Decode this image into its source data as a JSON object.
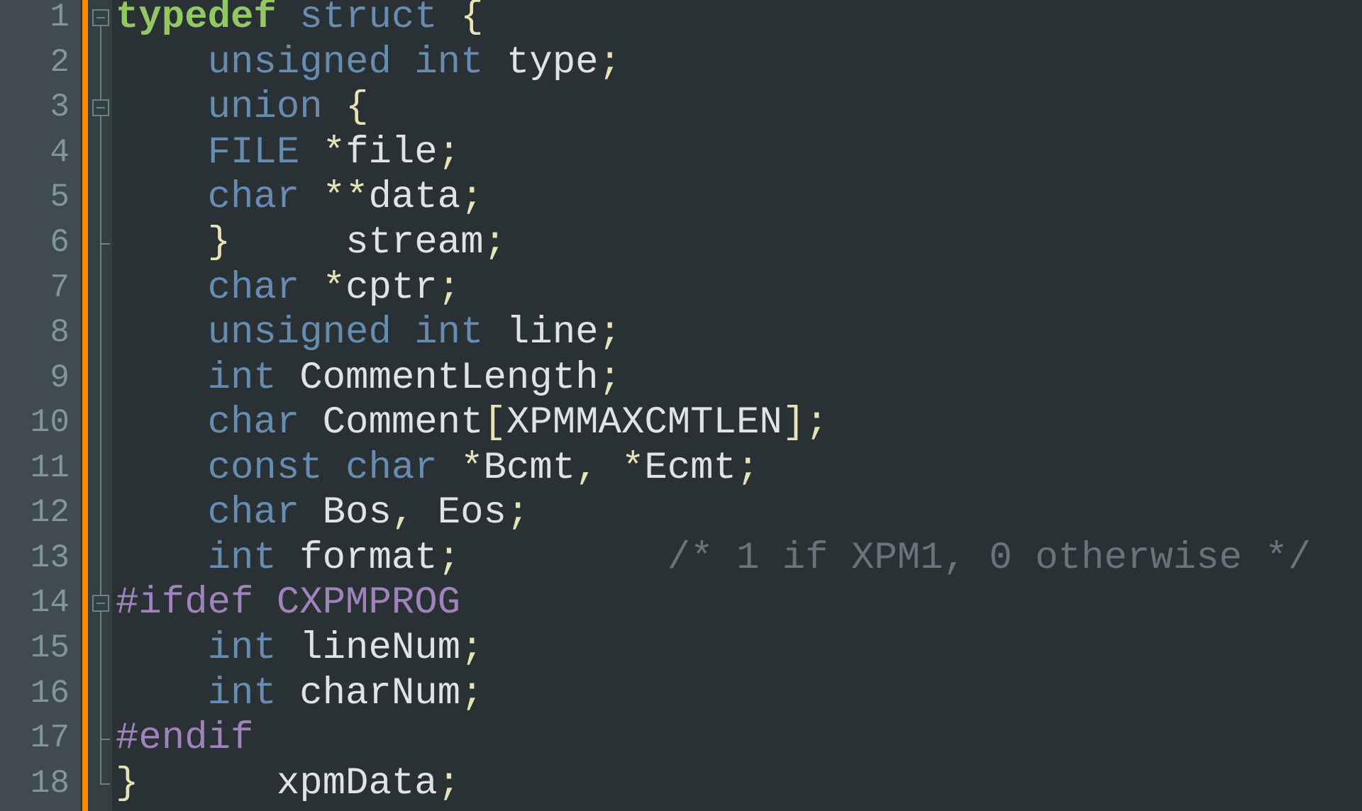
{
  "editor": {
    "theme_colors": {
      "background": "#293134",
      "gutter": "#3f4b4e",
      "change_bar": "#ff8a00",
      "fold_margin": "#343f42",
      "line_number": "#81969a",
      "keyword": "#93c763",
      "type": "#678cb1",
      "identifier": "#e0e2e4",
      "operator": "#e8e2b7",
      "preprocessor": "#a082bd",
      "comment": "#66747b"
    },
    "lines": [
      {
        "number": "1",
        "fold": "open",
        "tokens": [
          {
            "t": "kwd",
            "v": "typedef"
          },
          {
            "t": "ws",
            "v": " "
          },
          {
            "t": "type",
            "v": "struct"
          },
          {
            "t": "ws",
            "v": " "
          },
          {
            "t": "op",
            "v": "{"
          }
        ]
      },
      {
        "number": "2",
        "fold": "line",
        "tokens": [
          {
            "t": "ws",
            "v": "    "
          },
          {
            "t": "type",
            "v": "unsigned"
          },
          {
            "t": "ws",
            "v": " "
          },
          {
            "t": "type",
            "v": "int"
          },
          {
            "t": "ws",
            "v": " "
          },
          {
            "t": "id",
            "v": "type"
          },
          {
            "t": "op",
            "v": ";"
          }
        ]
      },
      {
        "number": "3",
        "fold": "open",
        "tokens": [
          {
            "t": "ws",
            "v": "    "
          },
          {
            "t": "type",
            "v": "union"
          },
          {
            "t": "ws",
            "v": " "
          },
          {
            "t": "op",
            "v": "{"
          }
        ]
      },
      {
        "number": "4",
        "fold": "line",
        "tokens": [
          {
            "t": "ws",
            "v": "    "
          },
          {
            "t": "type",
            "v": "FILE"
          },
          {
            "t": "ws",
            "v": " "
          },
          {
            "t": "op",
            "v": "*"
          },
          {
            "t": "id",
            "v": "file"
          },
          {
            "t": "op",
            "v": ";"
          }
        ]
      },
      {
        "number": "5",
        "fold": "line",
        "tokens": [
          {
            "t": "ws",
            "v": "    "
          },
          {
            "t": "type",
            "v": "char"
          },
          {
            "t": "ws",
            "v": " "
          },
          {
            "t": "op",
            "v": "**"
          },
          {
            "t": "id",
            "v": "data"
          },
          {
            "t": "op",
            "v": ";"
          }
        ]
      },
      {
        "number": "6",
        "fold": "end",
        "tokens": [
          {
            "t": "ws",
            "v": "    "
          },
          {
            "t": "op",
            "v": "}"
          },
          {
            "t": "ws",
            "v": "     "
          },
          {
            "t": "id",
            "v": "stream"
          },
          {
            "t": "op",
            "v": ";"
          }
        ]
      },
      {
        "number": "7",
        "fold": "line",
        "tokens": [
          {
            "t": "ws",
            "v": "    "
          },
          {
            "t": "type",
            "v": "char"
          },
          {
            "t": "ws",
            "v": " "
          },
          {
            "t": "op",
            "v": "*"
          },
          {
            "t": "id",
            "v": "cptr"
          },
          {
            "t": "op",
            "v": ";"
          }
        ]
      },
      {
        "number": "8",
        "fold": "line",
        "tokens": [
          {
            "t": "ws",
            "v": "    "
          },
          {
            "t": "type",
            "v": "unsigned"
          },
          {
            "t": "ws",
            "v": " "
          },
          {
            "t": "type",
            "v": "int"
          },
          {
            "t": "ws",
            "v": " "
          },
          {
            "t": "id",
            "v": "line"
          },
          {
            "t": "op",
            "v": ";"
          }
        ]
      },
      {
        "number": "9",
        "fold": "line",
        "tokens": [
          {
            "t": "ws",
            "v": "    "
          },
          {
            "t": "type",
            "v": "int"
          },
          {
            "t": "ws",
            "v": " "
          },
          {
            "t": "id",
            "v": "CommentLength"
          },
          {
            "t": "op",
            "v": ";"
          }
        ]
      },
      {
        "number": "10",
        "fold": "line",
        "tokens": [
          {
            "t": "ws",
            "v": "    "
          },
          {
            "t": "type",
            "v": "char"
          },
          {
            "t": "ws",
            "v": " "
          },
          {
            "t": "id",
            "v": "Comment"
          },
          {
            "t": "op",
            "v": "["
          },
          {
            "t": "id",
            "v": "XPMMAXCMTLEN"
          },
          {
            "t": "op",
            "v": "];"
          }
        ]
      },
      {
        "number": "11",
        "fold": "line",
        "tokens": [
          {
            "t": "ws",
            "v": "    "
          },
          {
            "t": "type",
            "v": "const"
          },
          {
            "t": "ws",
            "v": " "
          },
          {
            "t": "type",
            "v": "char"
          },
          {
            "t": "ws",
            "v": " "
          },
          {
            "t": "op",
            "v": "*"
          },
          {
            "t": "id",
            "v": "Bcmt"
          },
          {
            "t": "op",
            "v": ","
          },
          {
            "t": "ws",
            "v": " "
          },
          {
            "t": "op",
            "v": "*"
          },
          {
            "t": "id",
            "v": "Ecmt"
          },
          {
            "t": "op",
            "v": ";"
          }
        ]
      },
      {
        "number": "12",
        "fold": "line",
        "tokens": [
          {
            "t": "ws",
            "v": "    "
          },
          {
            "t": "type",
            "v": "char"
          },
          {
            "t": "ws",
            "v": " "
          },
          {
            "t": "id",
            "v": "Bos"
          },
          {
            "t": "op",
            "v": ","
          },
          {
            "t": "ws",
            "v": " "
          },
          {
            "t": "id",
            "v": "Eos"
          },
          {
            "t": "op",
            "v": ";"
          }
        ]
      },
      {
        "number": "13",
        "fold": "line",
        "tokens": [
          {
            "t": "ws",
            "v": "    "
          },
          {
            "t": "type",
            "v": "int"
          },
          {
            "t": "ws",
            "v": " "
          },
          {
            "t": "id",
            "v": "format"
          },
          {
            "t": "op",
            "v": ";"
          },
          {
            "t": "ws",
            "v": "         "
          },
          {
            "t": "cmt",
            "v": "/* 1 if XPM1, 0 otherwise */"
          }
        ]
      },
      {
        "number": "14",
        "fold": "open",
        "tokens": [
          {
            "t": "pre",
            "v": "#ifdef"
          },
          {
            "t": "ws",
            "v": " "
          },
          {
            "t": "pre",
            "v": "CXPMPROG"
          }
        ]
      },
      {
        "number": "15",
        "fold": "line",
        "tokens": [
          {
            "t": "ws",
            "v": "    "
          },
          {
            "t": "type",
            "v": "int"
          },
          {
            "t": "ws",
            "v": " "
          },
          {
            "t": "id",
            "v": "lineNum"
          },
          {
            "t": "op",
            "v": ";"
          }
        ]
      },
      {
        "number": "16",
        "fold": "line",
        "tokens": [
          {
            "t": "ws",
            "v": "    "
          },
          {
            "t": "type",
            "v": "int"
          },
          {
            "t": "ws",
            "v": " "
          },
          {
            "t": "id",
            "v": "charNum"
          },
          {
            "t": "op",
            "v": ";"
          }
        ]
      },
      {
        "number": "17",
        "fold": "end",
        "tokens": [
          {
            "t": "pre",
            "v": "#endif"
          }
        ]
      },
      {
        "number": "18",
        "fold": "last",
        "tokens": [
          {
            "t": "op",
            "v": "}"
          },
          {
            "t": "ws",
            "v": "      "
          },
          {
            "t": "id",
            "v": "xpmData"
          },
          {
            "t": "op",
            "v": ";"
          }
        ]
      }
    ]
  }
}
